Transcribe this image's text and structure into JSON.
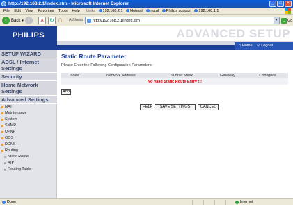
{
  "window": {
    "title": "http://192.168.2.1/index.stm - Microsoft Internet Explorer",
    "buttons": {
      "minimize": "_",
      "maximize": "□",
      "close": "×"
    }
  },
  "menubar": {
    "items": [
      "File",
      "Edit",
      "View",
      "Favorites",
      "Tools",
      "Help"
    ],
    "links_label": "Links",
    "links": [
      "192.168.2.1",
      "Hotmail",
      "nu.nl",
      "Philips support",
      "192.168.1.1"
    ]
  },
  "toolbar": {
    "back_label": "Back",
    "address_label": "Address",
    "address_value": "http://192.168.2.1/index.stm",
    "go_label": "Go"
  },
  "header": {
    "logo_text": "PHILIPS",
    "title": "ADVANCED SETUP",
    "home_link": "Home",
    "logout_link": "Logout"
  },
  "sidebar": {
    "sections": [
      "SETUP WIZARD",
      "ADSL / Internet Settings",
      "Security",
      "Home Network Settings",
      "Advanced Settings"
    ],
    "advanced_items": [
      "NAT",
      "Maintenance",
      "System",
      "SNMP",
      "UPNP",
      "QOS",
      "DDNS",
      "Routing"
    ],
    "routing_items": [
      "Static Route",
      "RIP",
      "Routing Table"
    ]
  },
  "main": {
    "title": "Static Route Parameter",
    "instructions": "Please Enter the Following Configuration Parameters:",
    "table_headers": [
      "Index",
      "Network Address",
      "Subnet Mask",
      "Gateway",
      "Configure"
    ],
    "empty_message": "No Valid Static Route Entry !!!",
    "add_button": "Add",
    "help_button": "HELP",
    "save_button": "SAVE SETTINGS",
    "cancel_button": "CANCEL"
  },
  "statusbar": {
    "left_text": "Done",
    "zone_text": "Internet"
  },
  "colors": {
    "brand_blue": "#1a3e93",
    "error_red": "#d00000",
    "sidebar_bg": "#e3e4ea"
  }
}
